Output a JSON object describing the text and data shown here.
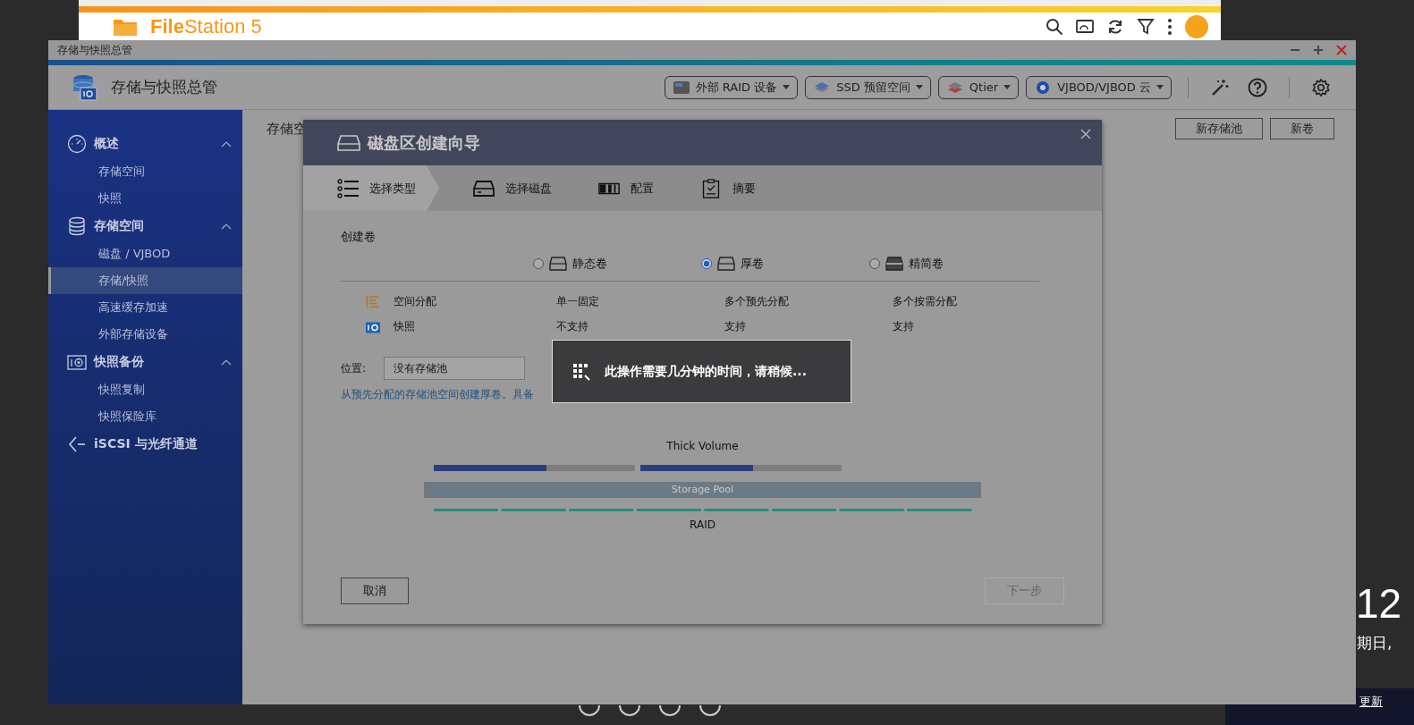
{
  "desktop": {
    "clock": "12",
    "date": "期日,",
    "update_link": "更新"
  },
  "background_window": {
    "app_name": "**File**Station 5"
  },
  "window": {
    "title": "存储与快照总管"
  },
  "header": {
    "app_name": "存储与快照总管",
    "menus": [
      {
        "label": "外部 RAID 设备"
      },
      {
        "label": "SSD 预留空间"
      },
      {
        "label": "Qtier"
      },
      {
        "label": "VJBOD/VJBOD 云"
      }
    ]
  },
  "sidebar": {
    "sections": [
      {
        "label": "概述",
        "expanded": true,
        "children": [
          {
            "label": "存储空间",
            "selected": false
          },
          {
            "label": "快照",
            "selected": false
          }
        ]
      },
      {
        "label": "存储空间",
        "expanded": true,
        "children": [
          {
            "label": "磁盘 / VJBOD",
            "selected": false
          },
          {
            "label": "存储/快照",
            "selected": true
          },
          {
            "label": "高速缓存加速",
            "selected": false
          },
          {
            "label": "外部存储设备",
            "selected": false
          }
        ]
      },
      {
        "label": "快照备份",
        "expanded": true,
        "children": [
          {
            "label": "快照复制",
            "selected": false
          },
          {
            "label": "快照保险库",
            "selected": false
          }
        ]
      },
      {
        "label": "iSCSI 与光纤通道"
      }
    ]
  },
  "content": {
    "title": "存储空",
    "buttons": [
      "新存储池",
      "新卷"
    ]
  },
  "dialog": {
    "title": "磁盘区创建向导",
    "steps": [
      {
        "label": "选择类型",
        "selected": true
      },
      {
        "label": "选择磁盘",
        "selected": false
      },
      {
        "label": "配置",
        "selected": false
      },
      {
        "label": "摘要",
        "selected": false
      }
    ],
    "section_title": "创建卷",
    "volume_types": [
      {
        "label": "静态卷",
        "selected": false
      },
      {
        "label": "厚卷",
        "selected": true
      },
      {
        "label": "精简卷",
        "selected": false
      }
    ],
    "comparison": [
      {
        "label": "空间分配",
        "values": [
          "单一固定",
          "多个预先分配",
          "多个按需分配"
        ]
      },
      {
        "label": "快照",
        "values": [
          "不支持",
          "支持",
          "支持"
        ]
      }
    ],
    "location": {
      "label": "位置:",
      "value": "没有存储池"
    },
    "description": "从预先分配的存储池空间创建厚卷。具备",
    "diagram": {
      "title": "Thick Volume",
      "volumes": [
        {
          "level": 0.56
        },
        {
          "level": 0.56
        }
      ],
      "pool_label": "Storage Pool",
      "raid_label": "RAID"
    },
    "buttons": [
      {
        "label": "取消",
        "disabled": false
      },
      {
        "label": "下一步",
        "disabled": true
      }
    ]
  },
  "toast": {
    "message": "此操作需要几分钟的时间，请稍候..."
  }
}
